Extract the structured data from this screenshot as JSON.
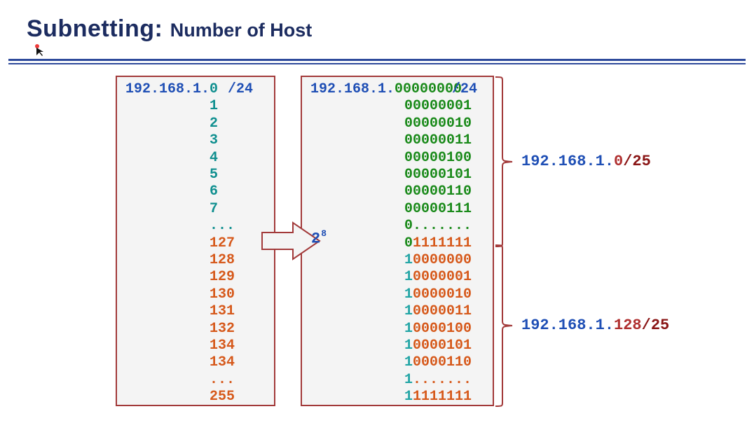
{
  "title_main": "Subnetting:",
  "title_sub": "Number of Host",
  "left": {
    "prefix": "192.168.1.",
    "cidr": "/24",
    "rows": [
      "0",
      "1",
      "2",
      "3",
      "4",
      "5",
      "6",
      "7",
      "...",
      "127",
      "128",
      "129",
      "130",
      "131",
      "132",
      "134",
      "134",
      "...",
      "255"
    ],
    "row_colors": [
      "teal",
      "teal",
      "teal",
      "teal",
      "teal",
      "teal",
      "teal",
      "teal",
      "teal",
      "host-teal",
      "host-teal",
      "host-teal",
      "host-teal",
      "host-teal",
      "host-teal",
      "host-teal",
      "host-teal",
      "host-teal",
      "host-teal"
    ]
  },
  "right": {
    "prefix": "192.168.1.",
    "cidr": "/24",
    "rows": [
      {
        "msb": "0",
        "bits": "0000000"
      },
      {
        "msb": "0",
        "bits": "0000001"
      },
      {
        "msb": "0",
        "bits": "0000010"
      },
      {
        "msb": "0",
        "bits": "0000011"
      },
      {
        "msb": "0",
        "bits": "0000100"
      },
      {
        "msb": "0",
        "bits": "0000101"
      },
      {
        "msb": "0",
        "bits": "0000110"
      },
      {
        "msb": "0",
        "bits": "0000111"
      },
      {
        "msb": "0",
        "bits": "......."
      },
      {
        "msb": "0",
        "bits": "1111111"
      },
      {
        "msb": "1",
        "bits": "0000000"
      },
      {
        "msb": "1",
        "bits": "0000001"
      },
      {
        "msb": "1",
        "bits": "0000010"
      },
      {
        "msb": "1",
        "bits": "0000011"
      },
      {
        "msb": "1",
        "bits": "0000100"
      },
      {
        "msb": "1",
        "bits": "0000101"
      },
      {
        "msb": "1",
        "bits": "0000110"
      },
      {
        "msb": "1",
        "bits": "......."
      },
      {
        "msb": "1",
        "bits": "1111111"
      }
    ],
    "bit_colors": [
      "green-bit",
      "green-bit",
      "green-bit",
      "green-bit",
      "green-bit",
      "green-bit",
      "green-bit",
      "green-bit",
      "green-bit",
      "orange-bit",
      "orange-bit",
      "orange-bit",
      "orange-bit",
      "orange-bit",
      "orange-bit",
      "orange-bit",
      "orange-bit",
      "orange-bit",
      "orange-bit"
    ],
    "msb_colors": [
      "green-bit",
      "green-bit",
      "green-bit",
      "green-bit",
      "green-bit",
      "green-bit",
      "green-bit",
      "green-bit",
      "green-bit",
      "green-bit",
      "teal-bit",
      "teal-bit",
      "teal-bit",
      "teal-bit",
      "teal-bit",
      "teal-bit",
      "teal-bit",
      "teal-bit",
      "teal-bit"
    ]
  },
  "power_base": "2",
  "power_exp": "8",
  "anno_top": {
    "prefix": "192.168.1.",
    "host": "0",
    "cidr": "/25"
  },
  "anno_bottom": {
    "prefix": "192.168.1.",
    "host": "128",
    "cidr": "/25"
  }
}
